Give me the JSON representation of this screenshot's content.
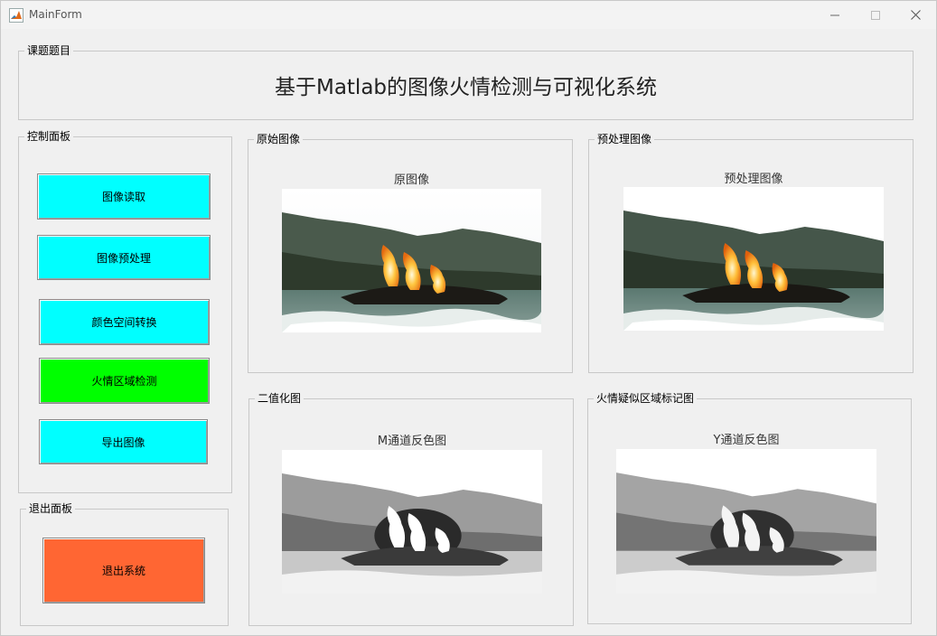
{
  "window": {
    "title": "MainForm",
    "icon": "matlab-icon"
  },
  "topic": {
    "legend": "课题题目",
    "title": "基于Matlab的图像火情检测与可视化系统"
  },
  "control_panel": {
    "legend": "控制面板",
    "buttons": [
      {
        "label": "图像读取",
        "color": "#00ffff"
      },
      {
        "label": "图像预处理",
        "color": "#00ffff"
      },
      {
        "label": "颜色空间转换",
        "color": "#00ffff"
      },
      {
        "label": "火情区域检测",
        "color": "#00ff00"
      },
      {
        "label": "导出图像",
        "color": "#00ffff"
      }
    ]
  },
  "exit_panel": {
    "legend": "退出面板",
    "button": {
      "label": "退出系统",
      "color": "#ff6633"
    }
  },
  "panels": {
    "original": {
      "legend": "原始图像",
      "axes_title": "原图像"
    },
    "preprocessed": {
      "legend": "预处理图像",
      "axes_title": "预处理图像"
    },
    "binary": {
      "legend": "二值化图",
      "axes_title": "M通道反色图"
    },
    "marked": {
      "legend": "火情疑似区域标记图",
      "axes_title": "Y通道反色图"
    }
  }
}
